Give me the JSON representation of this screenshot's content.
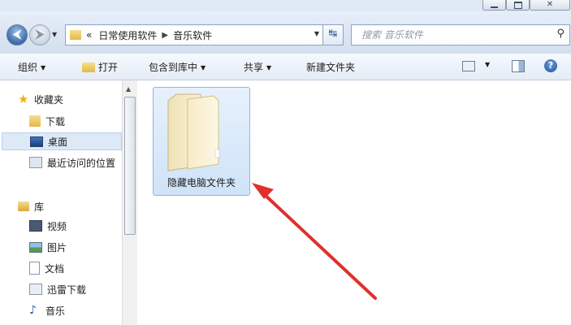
{
  "window": {
    "controls": [
      "minimize-icon",
      "maximize-icon",
      "close-icon"
    ]
  },
  "navigation": {
    "back_icon": "back-arrow-icon",
    "forward_icon": "forward-arrow-icon",
    "breadcrumb_prefix": "«",
    "breadcrumbs": [
      "日常使用软件",
      "音乐软件"
    ],
    "refresh_icon": "refresh-icon",
    "search_placeholder": "搜索 音乐软件"
  },
  "toolbar": {
    "organize": "组织",
    "open": "打开",
    "include_in_library": "包含到库中",
    "share": "共享",
    "new_folder": "新建文件夹"
  },
  "sidebar": {
    "favorites_title": "收藏夹",
    "favorites": [
      {
        "label": "下载",
        "icon": "download-folder-icon"
      },
      {
        "label": "桌面",
        "icon": "desktop-icon",
        "selected": true
      },
      {
        "label": "最近访问的位置",
        "icon": "recent-places-icon"
      }
    ],
    "libraries_title": "库",
    "libraries": [
      {
        "label": "视频",
        "icon": "video-icon"
      },
      {
        "label": "图片",
        "icon": "pictures-icon"
      },
      {
        "label": "文档",
        "icon": "documents-icon"
      },
      {
        "label": "迅雷下载",
        "icon": "download-icon"
      },
      {
        "label": "音乐",
        "icon": "music-icon"
      }
    ]
  },
  "content": {
    "items": [
      {
        "label": "隐藏电脑文件夹",
        "type": "folder",
        "selected": true
      }
    ]
  },
  "colors": {
    "selection": "#cfe3f8",
    "arrow": "#e0302c"
  }
}
